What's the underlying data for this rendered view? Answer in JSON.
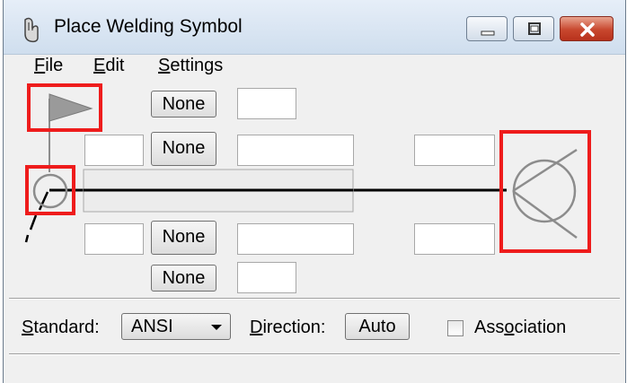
{
  "window": {
    "title": "Place Welding Symbol"
  },
  "menu": [
    {
      "label": "File",
      "underline": "F",
      "rest": "ile"
    },
    {
      "label": "Edit",
      "underline": "E",
      "rest": "dit"
    },
    {
      "label": "Settings",
      "underline": "S",
      "rest": "ettings"
    }
  ],
  "arrow_side": {
    "top_row_button": "None",
    "upper_row_button": "None",
    "lower_row_button": "None",
    "bottom_row_button": "None",
    "fields": {
      "top_right": "",
      "upper_left": "",
      "upper_mid": "",
      "upper_right": "",
      "lower_left": "",
      "lower_mid": "",
      "lower_right": "",
      "bottom_right": ""
    }
  },
  "footer": {
    "standard_label": "Standard:",
    "standard_label_u": "S",
    "standard_label_rest": "tandard:",
    "standard_value": "ANSI",
    "direction_label": "Direction:",
    "direction_label_u": "D",
    "direction_label_rest": "irection:",
    "direction_value": "Auto",
    "association_label": "Association",
    "association_pre": "Ass",
    "association_u": "o",
    "association_post": "ciation",
    "association_checked": false
  },
  "colors": {
    "highlight_red": "#ee1c1c",
    "close_button": "#c8472e",
    "titlebar": "#dbe6f3"
  },
  "icons": [
    "app-icon",
    "minimize-icon",
    "maximize-icon",
    "close-icon",
    "flag-icon",
    "field-weld-circle-icon",
    "tail-icon",
    "dropdown-arrow-icon"
  ]
}
